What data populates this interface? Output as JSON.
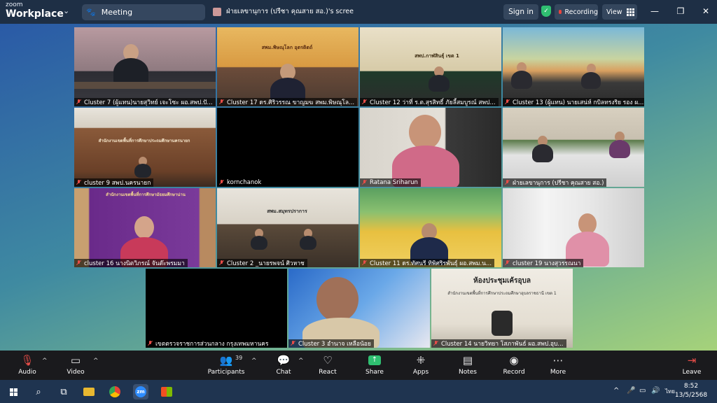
{
  "titlebar": {
    "brand_small": "zoom",
    "brand_large": "Workplace",
    "meeting_tab": "Meeting",
    "share_tab": "ฝ่ายเลขานุการ (ปรีชา  คุณสาย สอ.)'s scree",
    "sign_in": "Sign in",
    "recording": "Recording",
    "view": "View",
    "minimize": "—",
    "restore": "❐",
    "close": "✕"
  },
  "tiles": [
    {
      "name": "Cluster 7 (ผู้แทน)นายสุวิทย์ เจะโซะ ผอ.สพป.ปั..."
    },
    {
      "name": "Cluster 17 ดร.ศิริวรรณ ขาญมฆ สพม.พิษณุโล..."
    },
    {
      "name": "Cluster 12 ว่าที่ ร.ต.สุรสิทธิ์ ภัยลี้สมบูรณ์ สพป..."
    },
    {
      "name": "Cluster 13 (ผู้แทน) นายเสน่ห์ กบิลทรงริย รอง ผ..."
    },
    {
      "name": "cluster 9 สพป.นครนายก"
    },
    {
      "name": "kornchanok"
    },
    {
      "name": "Ratana Sriharun"
    },
    {
      "name": "ฝ่ายเลขานุการ (ปรีชา  คุณสาย สอ.)"
    },
    {
      "name": "cluster 16 นางนิตวิภรณ์ จันต๊ะพรมมา"
    },
    {
      "name": "Cluster 2 _นายรพจน์ ศิวหาช"
    },
    {
      "name": "Cluster 11 ดร.ทัศนรี ทิพิศริรพันธุ์ ผอ.สพม.น..."
    },
    {
      "name": "cluster 19 นางสุวรรณนา"
    },
    {
      "name": "เขตตรวจราชการส่วนกลาง กรุงเทพมหานคร"
    },
    {
      "name": "Cluster 3 อำนาจ เหลือน้อย"
    },
    {
      "name": "Cluster 14 นายวิทยา โสภาพันธ์ ผอ.สพป.อุบ..."
    }
  ],
  "scene_text": {
    "t2_sign": "สพม.พิษณุโลก อุตรดิตถ์",
    "t3_sign": "สพป.กาฬสินธุ์ เขต 1",
    "t5_sign": "สำนักงานเขตพื้นที่การศึกษาประถมศึกษานครนายก",
    "t9_sign": "สำนักงานเขตพื้นที่การศึกษามัธยมศึกษาน่าน",
    "t10_sign": "สพม.สมุทรปราการ",
    "t15_title": "ห้องประชุมเค้รอุบล",
    "t15_sub": "สำนักงานเขตพื้นที่การศึกษาประถมศึกษาอุบลราชธานี เขต 1"
  },
  "toolbar": {
    "audio": "Audio",
    "video": "Video",
    "participants": "Participants",
    "participants_count": "39",
    "chat": "Chat",
    "react": "React",
    "share": "Share",
    "apps": "Apps",
    "notes": "Notes",
    "record": "Record",
    "more": "More",
    "leave": "Leave"
  },
  "taskbar": {
    "lang": "ไทย",
    "time": "8:52",
    "date": "13/5/2568"
  },
  "colors": {
    "titlebar": "#1e2f45",
    "toolbar": "#1a1a1d",
    "active_border": "#6ad17a",
    "record_dot": "#e9443e",
    "shield": "#2fbf71"
  }
}
